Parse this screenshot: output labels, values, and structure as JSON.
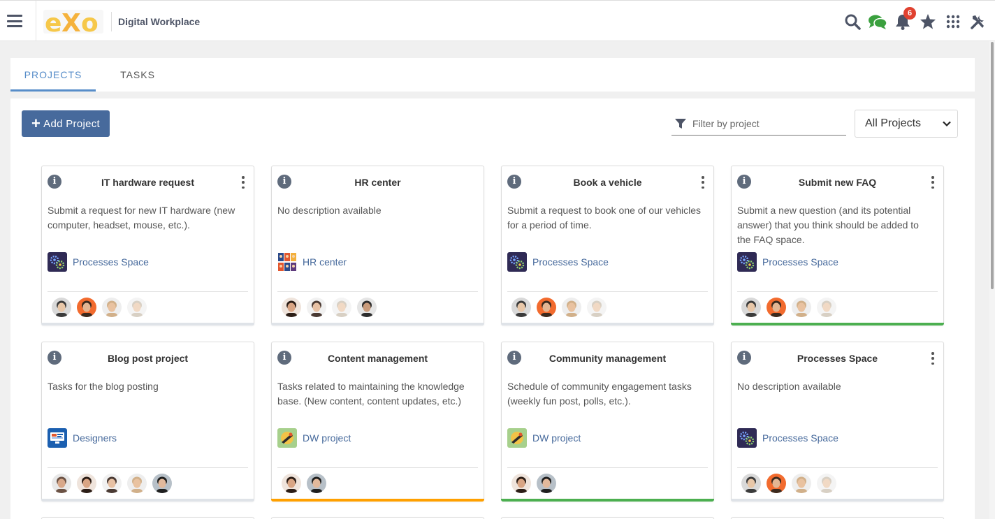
{
  "app": {
    "title": "Digital Workplace",
    "logo_text": "eXo"
  },
  "header": {
    "icons": [
      {
        "name": "search-icon"
      },
      {
        "name": "chat-icon"
      },
      {
        "name": "bell-icon",
        "badge": "6"
      },
      {
        "name": "star-icon"
      },
      {
        "name": "apps-grid-icon"
      },
      {
        "name": "admin-tools-icon"
      }
    ]
  },
  "tabs": [
    {
      "label": "PROJECTS",
      "active": true
    },
    {
      "label": "TASKS",
      "active": false
    }
  ],
  "toolbar": {
    "add_label": "Add Project",
    "filter_placeholder": "Filter by project",
    "select_value": "All Projects"
  },
  "colors": {
    "accent": "#578dc9",
    "button": "#476a9c",
    "green": "#4caf50",
    "orange": "#ffa000",
    "grey": "#dfe3e8"
  },
  "cards": [
    {
      "title": "IT hardware request",
      "menu": true,
      "description": "Submit a request for new IT hardware (new computer, headset, mouse, etc.).",
      "space": "Processes Space",
      "space_icon": "processes",
      "avatars": [
        "a1",
        "a2",
        "a3",
        "a4"
      ],
      "status_color": "#dfe3e8"
    },
    {
      "title": "HR center",
      "menu": false,
      "description": "No description available",
      "space": "HR center",
      "space_icon": "hr",
      "avatars": [
        "a5",
        "a6",
        "a4",
        "a7"
      ],
      "status_color": "#dfe3e8"
    },
    {
      "title": "Book a vehicle",
      "menu": true,
      "description": "Submit a request to book one of our vehicles for a period of time.",
      "space": "Processes Space",
      "space_icon": "processes",
      "avatars": [
        "a1",
        "a2",
        "a3",
        "a4"
      ],
      "status_color": "#dfe3e8"
    },
    {
      "title": "Submit new FAQ",
      "menu": true,
      "description": "Submit a new question (and its potential answer) that you think should be added to the FAQ space.",
      "space": "Processes Space",
      "space_icon": "processes",
      "avatars": [
        "a1",
        "a2",
        "a3",
        "a4"
      ],
      "status_color": "#4caf50"
    },
    {
      "title": "Blog post project",
      "menu": false,
      "description": "Tasks for the blog posting",
      "space": "Designers",
      "space_icon": "designers",
      "avatars": [
        "a8",
        "a5",
        "a6",
        "a3",
        "a9"
      ],
      "status_color": "#dfe3e8"
    },
    {
      "title": "Content management",
      "menu": false,
      "description": "Tasks related to maintaining the knowledge base. (New content, content updates, etc.)",
      "space": "DW project",
      "space_icon": "dw",
      "avatars": [
        "a5",
        "a9"
      ],
      "status_color": "#ffa000"
    },
    {
      "title": "Community management",
      "menu": false,
      "description": "Schedule of community engagement tasks (weekly fun post, polls, etc.).",
      "space": "DW project",
      "space_icon": "dw",
      "avatars": [
        "a5",
        "a9"
      ],
      "status_color": "#4caf50"
    },
    {
      "title": "Processes Space",
      "menu": true,
      "description": "No description available",
      "space": "Processes Space",
      "space_icon": "processes",
      "avatars": [
        "a1",
        "a2",
        "a3",
        "a4"
      ],
      "status_color": "#dfe3e8"
    }
  ]
}
